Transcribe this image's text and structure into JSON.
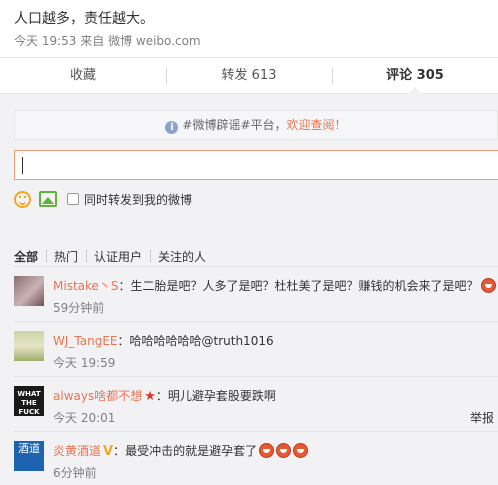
{
  "post": {
    "text": "人口越多，责任越大。",
    "meta_time": "今天 19:53",
    "meta_from": "来自",
    "meta_source": "微博 weibo.com"
  },
  "tabs": [
    {
      "label": "收藏"
    },
    {
      "label": "转发 613"
    },
    {
      "label": "评论 305"
    }
  ],
  "notice": {
    "icon": "info-icon",
    "text": "#微博辟谣#平台，",
    "link": "欢迎查阅！"
  },
  "comment_box": {
    "value": "",
    "also_repost_label": "同时转发到我的微博",
    "also_repost_checked": false
  },
  "filters": [
    "全部",
    "热门",
    "认证用户",
    "关注的人"
  ],
  "comments": [
    {
      "user": "Mistake丶S",
      "text": "：生二胎是吧？人多了是吧？杜杜美了是吧？赚钱的机会来了是吧？",
      "time": "59分钟前",
      "emoji_count": 1
    },
    {
      "user": "WJ_TangEE",
      "text": "：哈哈哈哈哈哈@truth1016",
      "time": "今天 19:59"
    },
    {
      "user": "always啥都不想",
      "badge": "star-icon",
      "text": "：明儿避孕套股要跌啊",
      "time": "今天 20:01",
      "action": "举报",
      "avatar_text": "WHAT THE FUCK"
    },
    {
      "user": "炎黄酒道",
      "badge": "v-icon",
      "text": "：最受冲击的就是避孕套了",
      "time": "6分钟前",
      "emoji_count": 3,
      "avatar_text": "酒道"
    }
  ],
  "colors": {
    "accent": "#eb7350",
    "panel_bg": "#f2f2f5",
    "muted": "#808080"
  }
}
